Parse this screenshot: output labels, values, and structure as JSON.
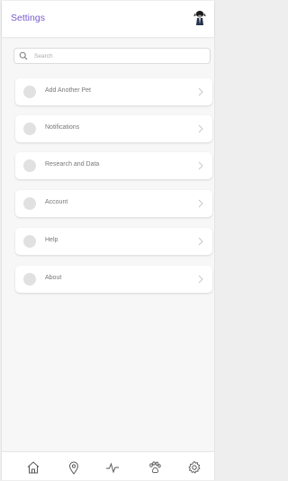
{
  "header": {
    "title": "Settings",
    "title_color": "#7a5ccf",
    "avatar_icon": "dog-avatar-icon"
  },
  "search": {
    "placeholder": "Search",
    "value": ""
  },
  "settings_items": [
    {
      "label": "Add Another Pet"
    },
    {
      "label": "Notifications"
    },
    {
      "label": "Research and Data"
    },
    {
      "label": "Account"
    },
    {
      "label": "Help"
    },
    {
      "label": "About"
    }
  ],
  "bottom_nav": [
    {
      "icon": "home-icon"
    },
    {
      "icon": "location-pin-icon"
    },
    {
      "icon": "activity-pulse-icon"
    },
    {
      "icon": "paw-icon"
    },
    {
      "icon": "gear-icon"
    }
  ]
}
